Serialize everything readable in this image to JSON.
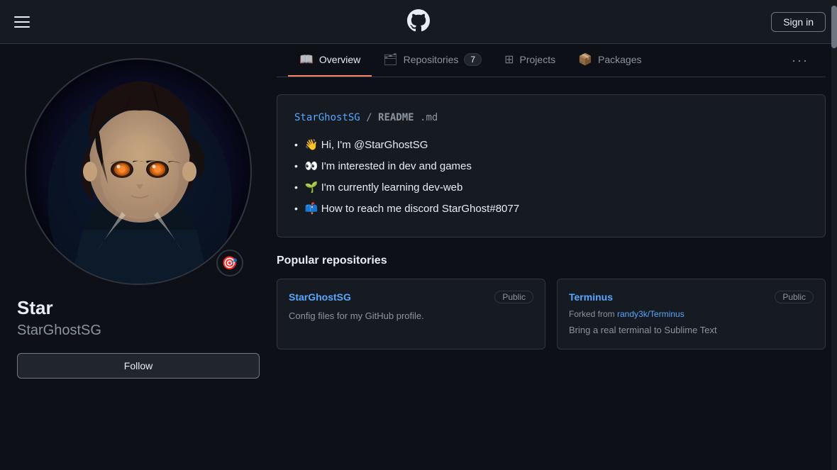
{
  "header": {
    "logo_label": "GitHub",
    "sign_in_label": "Sign in"
  },
  "tabs": {
    "more_label": "···",
    "items": [
      {
        "id": "overview",
        "label": "Overview",
        "active": true,
        "badge": null,
        "icon": "📖"
      },
      {
        "id": "repositories",
        "label": "Repositories",
        "active": false,
        "badge": "7",
        "icon": "🗂"
      },
      {
        "id": "projects",
        "label": "Projects",
        "active": false,
        "badge": null,
        "icon": "⊞"
      },
      {
        "id": "packages",
        "label": "Packages",
        "active": false,
        "badge": null,
        "icon": "📦"
      }
    ]
  },
  "profile": {
    "display_name": "Star",
    "login_name": "StarGhostSG",
    "follow_label": "Follow"
  },
  "readme": {
    "header_repo": "StarGhostSG",
    "header_separator": " / ",
    "header_file_bold": "README",
    "header_file_ext": ".md",
    "items": [
      {
        "emoji": "👋",
        "text": "Hi, I'm @StarGhostSG"
      },
      {
        "emoji": "👀",
        "text": "I'm interested in dev and games"
      },
      {
        "emoji": "🌱",
        "text": "I'm currently learning dev-web"
      },
      {
        "emoji": "📫",
        "text": "How to reach me discord StarGhost#8077"
      }
    ]
  },
  "popular_repos": {
    "title": "Popular repositories",
    "repos": [
      {
        "name": "StarGhostSG",
        "badge": "Public",
        "forked": null,
        "forked_from": null,
        "desc": "Config files for my GitHub profile."
      },
      {
        "name": "Terminus",
        "badge": "Public",
        "forked": true,
        "forked_from": "randy3k/Terminus",
        "desc": "Bring a real terminal to Sublime Text"
      }
    ]
  }
}
